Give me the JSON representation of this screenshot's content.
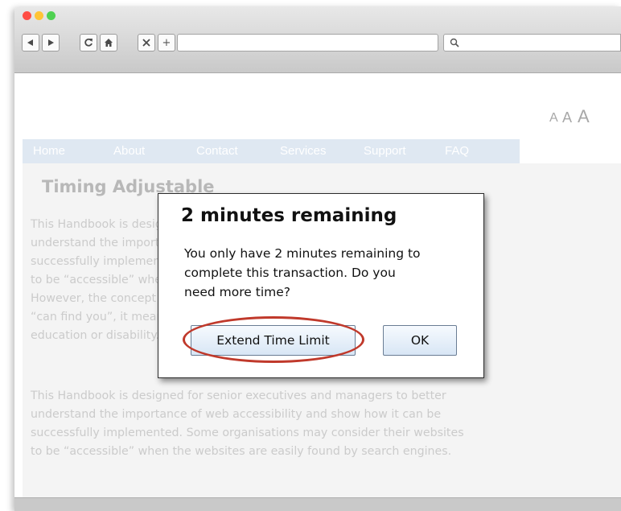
{
  "browser": {
    "toolbar": {
      "back_icon": "back-arrow-icon",
      "forward_icon": "forward-arrow-icon",
      "reload_icon": "reload-icon",
      "home_icon": "home-icon",
      "stop_icon": "close-icon",
      "new_tab_label": "+",
      "address_value": "",
      "search_value": ""
    }
  },
  "page": {
    "text_size_options": [
      "A",
      "A",
      "A"
    ],
    "nav": [
      "Home",
      "About",
      "Contact",
      "Services",
      "Support",
      "FAQ"
    ],
    "heading": "Timing Adjustable",
    "paragraph1_lines": [
      "This Handbook is designed for senior executives and managers to better",
      "understand the importance of web accessibility and show how it can be",
      "successfully implemented. Some organisations may consider their websites",
      "to be “accessible” when the websites are easily found by search engines.",
      "However, the concept of web accessibility relates more to whether people",
      "“can find you”, it means anyone regardless of disability, age, race,",
      "education or disability."
    ],
    "paragraph2_lines": [
      "This Handbook is designed for senior executives and managers to better",
      "understand the importance of web accessibility and show how it can be",
      "successfully implemented. Some organisations may consider their websites",
      "to be “accessible” when the websites are easily found by search engines."
    ]
  },
  "dialog": {
    "title": "2 minutes remaining",
    "message_lines": [
      "You only have 2 minutes remaining to",
      "complete this transaction. Do you",
      "need more time?"
    ],
    "extend_button": "Extend Time Limit",
    "ok_button": "OK"
  },
  "colors": {
    "highlight_ring": "#c0392b",
    "menu_background": "#dfe8f2",
    "close_red": "#ff4d44",
    "minimize_yellow": "#ffc436",
    "zoom_green": "#4fd151"
  }
}
